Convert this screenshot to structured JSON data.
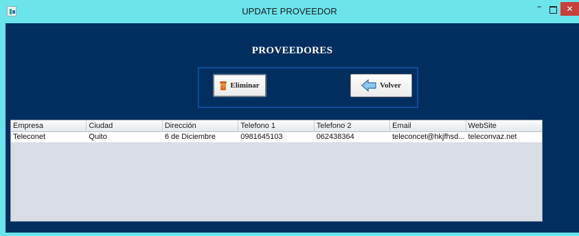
{
  "window": {
    "title": "UPDATE PROVEEDOR",
    "minimize_glyph": "–",
    "close_glyph": "✕"
  },
  "heading": "PROVEEDORES",
  "buttons": {
    "delete_label": "Eliminar",
    "back_label": "Volver"
  },
  "icons": {
    "app": "java-app-icon",
    "delete": "trash-icon",
    "back": "back-arrow-icon"
  },
  "colors": {
    "titlebar": "#6ce4ec",
    "background": "#002f5f",
    "close_button": "#c7403b"
  },
  "table": {
    "columns": [
      "Empresa",
      "Ciudad",
      "Dirección",
      "Telefono 1",
      "Telefono 2",
      "Email",
      "WebSite"
    ],
    "rows": [
      [
        "Teleconet",
        "Quito",
        "6 de Diciembre",
        "0981645103",
        "062438364",
        "teleconcet@hkjfhsd...",
        "teleconvaz.net"
      ]
    ]
  }
}
